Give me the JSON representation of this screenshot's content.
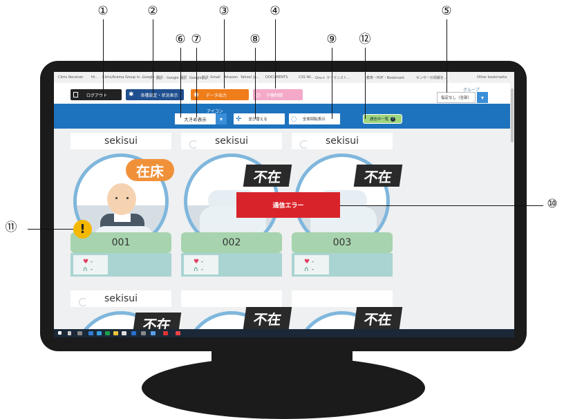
{
  "callouts": [
    "①",
    "②",
    "③",
    "④",
    "⑤",
    "⑥",
    "⑦",
    "⑧",
    "⑨",
    "⑫",
    "⑩",
    "⑪"
  ],
  "bookmarks": [
    "Citrix Receiver",
    "Hi...",
    "Citrix/Arama Group in...",
    "Google",
    "翻訳 - Google 翻訳",
    "Google翻訳",
    "Gmail",
    "Amazon",
    "Yahoo! Ja...",
    "DOCUMENTS",
    "CSS Wi...",
    "Gnu+ ラーマンスト...",
    "教育・PDF・Bookmark",
    "センサーの情報を...",
    "Other bookmarks"
  ],
  "toolbar": {
    "logout_label": "ログアウト",
    "settings_label": "各種設定・状況表示",
    "data_output_label": "データ出力",
    "unlabeled_label": "子機制御"
  },
  "group": {
    "label": "グループ",
    "selected": "指定なし（全部）"
  },
  "icon_bar": {
    "label": "アイコン",
    "size_selected": "大きめ表示",
    "sort_label": "並び替える",
    "rotate_label": "全体回転表示",
    "comm_list_label": "通信中一覧"
  },
  "cards": [
    {
      "name": "sekisui",
      "status": "在床",
      "status_type": "present",
      "id": "001",
      "heart": "-",
      "resp": "-"
    },
    {
      "name": "sekisui",
      "status": "不在",
      "status_type": "absent",
      "id": "002",
      "heart": "-",
      "resp": "-"
    },
    {
      "name": "sekisui",
      "status": "不在",
      "status_type": "absent",
      "id": "003",
      "heart": "-",
      "resp": "-"
    },
    {
      "name": "sekisui",
      "status": "不在",
      "status_type": "absent"
    },
    {
      "name": "",
      "status": "不在",
      "status_type": "absent"
    },
    {
      "name": "",
      "status": "不在",
      "status_type": "absent"
    }
  ],
  "error_text": "通信エラー",
  "warning_icon": "exclamation-icon",
  "colors": {
    "accent_blue": "#1e73be",
    "present": "#f0913a",
    "absent": "#2a2a2a",
    "error": "#d9232a",
    "warn": "#f5b800",
    "id_bar": "#a7d3ae"
  }
}
